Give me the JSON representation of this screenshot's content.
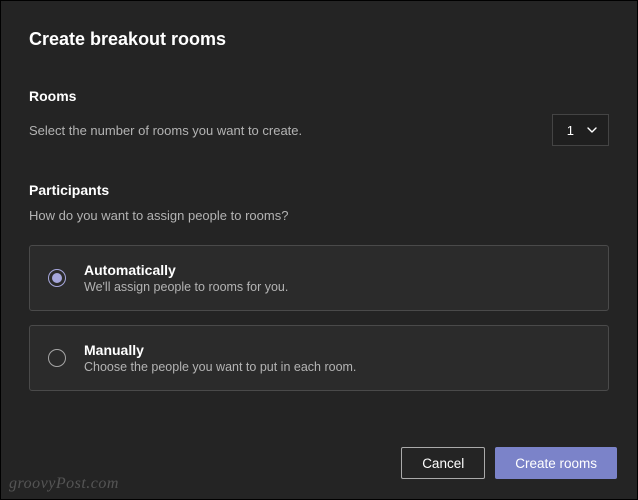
{
  "title": "Create breakout rooms",
  "rooms": {
    "heading": "Rooms",
    "description": "Select the number of rooms you want to create.",
    "selected_value": "1"
  },
  "participants": {
    "heading": "Participants",
    "description": "How do you want to assign people to rooms?",
    "options": [
      {
        "label": "Automatically",
        "description": "We'll assign people to rooms for you.",
        "selected": true
      },
      {
        "label": "Manually",
        "description": "Choose the people you want to put in each room.",
        "selected": false
      }
    ]
  },
  "buttons": {
    "cancel": "Cancel",
    "create": "Create rooms"
  },
  "watermark": "groovyPost.com"
}
